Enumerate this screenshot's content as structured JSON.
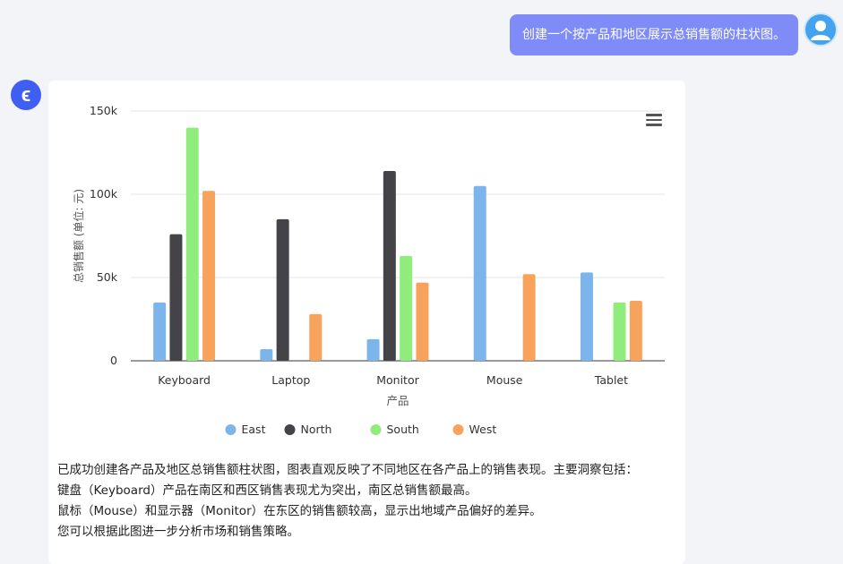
{
  "user_message": {
    "text": "创建一个按产品和地区展示总销售额的柱状图。"
  },
  "bot": {
    "avatar_letter": "ϵ",
    "response_lines": [
      "已成功创建各产品及地区总销售额柱状图，图表直观反映了不同地区在各产品上的销售表现。主要洞察包括：",
      "键盘（Keyboard）产品在南区和西区销售表现尤为突出，南区总销售额最高。",
      "鼠标（Mouse）和显示器（Monitor）在东区的销售额较高，显示出地域产品偏好的差异。",
      "您可以根据此图进一步分析市场和销售策略。"
    ]
  },
  "colors": {
    "East": "#7cb5ec",
    "North": "#434348",
    "South": "#90ed7d",
    "West": "#f7a35c"
  },
  "chart_data": {
    "type": "bar",
    "categories": [
      "Keyboard",
      "Laptop",
      "Monitor",
      "Mouse",
      "Tablet"
    ],
    "series": [
      {
        "name": "East",
        "values": [
          35000,
          7000,
          13000,
          105000,
          53000
        ]
      },
      {
        "name": "North",
        "values": [
          76000,
          85000,
          114000,
          0,
          0
        ]
      },
      {
        "name": "South",
        "values": [
          140000,
          0,
          63000,
          0,
          35000
        ]
      },
      {
        "name": "West",
        "values": [
          102000,
          28000,
          47000,
          52000,
          36000
        ]
      }
    ],
    "xlabel": "产品",
    "ylabel": "总销售额 (单位: 元)",
    "ylim": [
      0,
      150000
    ],
    "yticks": [
      {
        "value": 0,
        "label": "0"
      },
      {
        "value": 50000,
        "label": "50k"
      },
      {
        "value": 100000,
        "label": "100k"
      },
      {
        "value": 150000,
        "label": "150k"
      }
    ],
    "grid": true,
    "legend": "bottom-center"
  }
}
